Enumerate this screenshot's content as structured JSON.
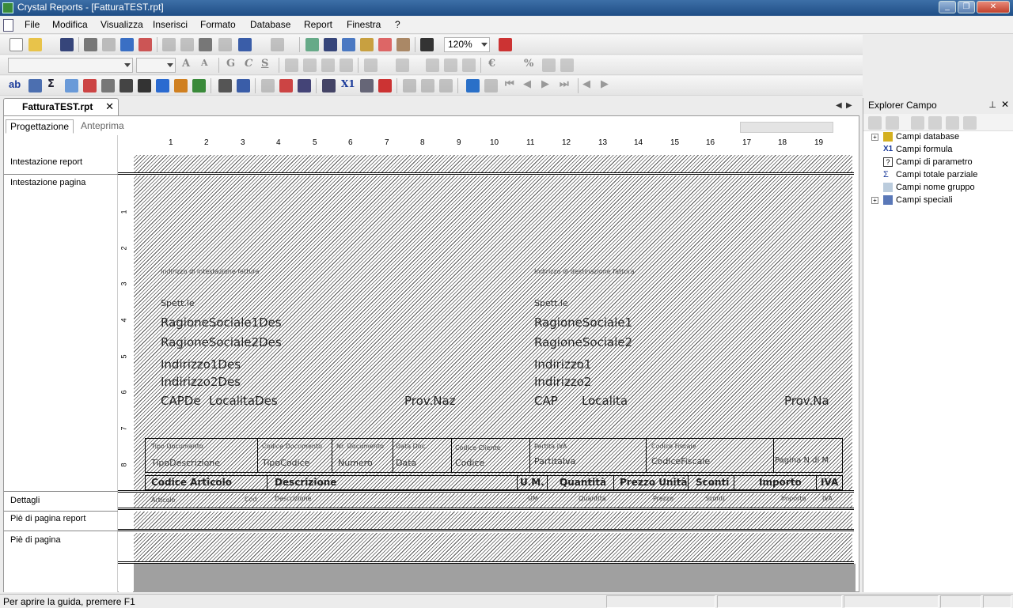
{
  "window": {
    "title": "Crystal Reports - [FatturaTEST.rpt]"
  },
  "menu": [
    "File",
    "Modifica",
    "Visualizza",
    "Inserisci",
    "Formato",
    "Database",
    "Report",
    "Finestra",
    "?"
  ],
  "toolbar": {
    "zoom": "120%"
  },
  "doc_tab": {
    "label": "FatturaTEST.rpt",
    "close": "✕"
  },
  "view_tabs": {
    "design": "Progettazione",
    "preview": "Anteprima"
  },
  "sections": [
    "Intestazione report",
    "Intestazione pagina",
    "Dettagli",
    "Piè di pagina report",
    "Piè di pagina"
  ],
  "ruler": [
    "1",
    "2",
    "3",
    "4",
    "5",
    "6",
    "7",
    "8",
    "9",
    "10",
    "11",
    "12",
    "13",
    "14",
    "15",
    "16",
    "17",
    "18",
    "19"
  ],
  "vruler": [
    "1",
    "2",
    "3",
    "4",
    "5",
    "6",
    "7",
    "8"
  ],
  "report": {
    "billing_caption": "Indirizzo di intestazione fattura",
    "shipping_caption": "Indirizzo di destinazione fattura",
    "spett_left": "Spett.le",
    "spett_right": "Spett.le",
    "left": [
      "RagioneSociale1Des",
      "RagioneSociale2Des",
      "Indirizzo1Des",
      "Indirizzo2Des"
    ],
    "left_cap": "CAPDe",
    "left_loc": "LocalitaDes",
    "left_prov": "Prov.Naz",
    "right": [
      "RagioneSociale1",
      "RagioneSociale2",
      "Indirizzo1",
      "Indirizzo2"
    ],
    "right_cap": "CAP",
    "right_loc": "Localita",
    "right_prov": "Prov.Na",
    "info_labels": [
      "Tipo Documento",
      "Codice Documento",
      "Nr. Documento",
      "Data Doc.",
      "Codice Cliente",
      "Partita IVA",
      "Codice Fiscale",
      ""
    ],
    "info_values": [
      "TipoDescrizione",
      "TipoCodice",
      "Numero",
      "Data",
      "Codice",
      "PartitaIva",
      "CodiceFiscale",
      "Pagina N di M"
    ],
    "col_headers": [
      "Codice Articolo",
      "Descrizione",
      "U.M.",
      "Quantità",
      "Prezzo Unità",
      "Sconti",
      "Importo",
      "IVA"
    ],
    "detail_fields": [
      "Articolo",
      "Cod",
      "Descrizione",
      "UM",
      "Quantita",
      "Prezzo",
      "Sconti",
      "Importo",
      "IVA"
    ]
  },
  "explorer": {
    "title": "Explorer Campo",
    "items": [
      "Campi database",
      "Campi formula",
      "Campi di parametro",
      "Campi totale parziale",
      "Campi nome gruppo",
      "Campi speciali"
    ]
  },
  "status": {
    "text": "Per aprire la guida, premere F1"
  }
}
